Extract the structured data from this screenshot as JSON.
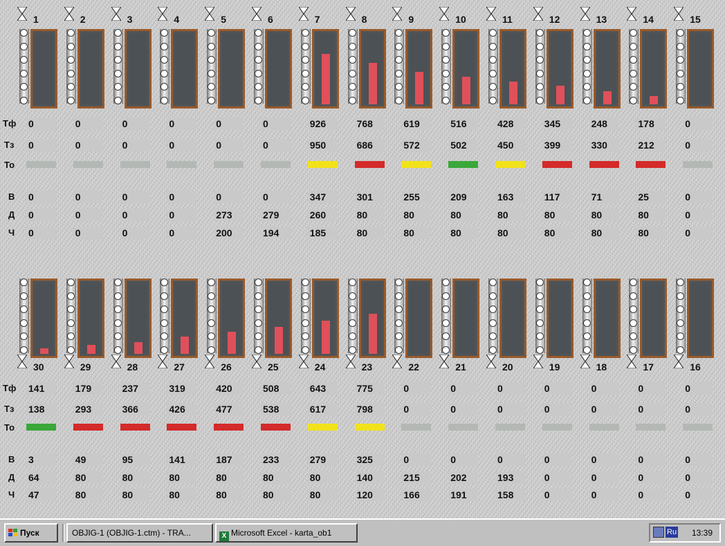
{
  "top": {
    "units": [
      {
        "n": "1",
        "fill": 0
      },
      {
        "n": "2",
        "fill": 0
      },
      {
        "n": "3",
        "fill": 0
      },
      {
        "n": "4",
        "fill": 0
      },
      {
        "n": "5",
        "fill": 0
      },
      {
        "n": "6",
        "fill": 0
      },
      {
        "n": "7",
        "fill": 0.71
      },
      {
        "n": "8",
        "fill": 0.58
      },
      {
        "n": "9",
        "fill": 0.46
      },
      {
        "n": "10",
        "fill": 0.39
      },
      {
        "n": "11",
        "fill": 0.32
      },
      {
        "n": "12",
        "fill": 0.26
      },
      {
        "n": "13",
        "fill": 0.18
      },
      {
        "n": "14",
        "fill": 0.12
      },
      {
        "n": "15",
        "fill": 0
      }
    ],
    "tf": [
      "0",
      "0",
      "0",
      "0",
      "0",
      "0",
      "926",
      "768",
      "619",
      "516",
      "428",
      "345",
      "248",
      "178",
      "0"
    ],
    "tz": [
      "0",
      "0",
      "0",
      "0",
      "0",
      "0",
      "950",
      "686",
      "572",
      "502",
      "450",
      "399",
      "330",
      "212",
      "0"
    ],
    "to": [
      "gray",
      "gray",
      "gray",
      "gray",
      "gray",
      "gray",
      "yellow",
      "red",
      "yellow",
      "green",
      "yellow",
      "red",
      "red",
      "red",
      "gray"
    ],
    "v": [
      "0",
      "0",
      "0",
      "0",
      "0",
      "0",
      "347",
      "301",
      "255",
      "209",
      "163",
      "117",
      "71",
      "25",
      "0"
    ],
    "d": [
      "0",
      "0",
      "0",
      "0",
      "273",
      "279",
      "260",
      "80",
      "80",
      "80",
      "80",
      "80",
      "80",
      "80",
      "0"
    ],
    "ch": [
      "0",
      "0",
      "0",
      "0",
      "200",
      "194",
      "185",
      "80",
      "80",
      "80",
      "80",
      "80",
      "80",
      "80",
      "0"
    ]
  },
  "bottom": {
    "units": [
      {
        "n": "30",
        "fill": 0.08
      },
      {
        "n": "29",
        "fill": 0.13
      },
      {
        "n": "28",
        "fill": 0.17
      },
      {
        "n": "27",
        "fill": 0.24
      },
      {
        "n": "26",
        "fill": 0.31
      },
      {
        "n": "25",
        "fill": 0.38
      },
      {
        "n": "24",
        "fill": 0.47
      },
      {
        "n": "23",
        "fill": 0.56
      },
      {
        "n": "22",
        "fill": 0
      },
      {
        "n": "21",
        "fill": 0
      },
      {
        "n": "20",
        "fill": 0
      },
      {
        "n": "19",
        "fill": 0
      },
      {
        "n": "18",
        "fill": 0
      },
      {
        "n": "17",
        "fill": 0
      },
      {
        "n": "16",
        "fill": 0
      }
    ],
    "tf": [
      "141",
      "179",
      "237",
      "319",
      "420",
      "508",
      "643",
      "775",
      "0",
      "0",
      "0",
      "0",
      "0",
      "0",
      "0"
    ],
    "tz": [
      "138",
      "293",
      "366",
      "426",
      "477",
      "538",
      "617",
      "798",
      "0",
      "0",
      "0",
      "0",
      "0",
      "0",
      "0"
    ],
    "to": [
      "green",
      "red",
      "red",
      "red",
      "red",
      "red",
      "yellow",
      "yellow",
      "gray",
      "gray",
      "gray",
      "gray",
      "gray",
      "gray",
      "gray"
    ],
    "v": [
      "3",
      "49",
      "95",
      "141",
      "187",
      "233",
      "279",
      "325",
      "0",
      "0",
      "0",
      "0",
      "0",
      "0",
      "0"
    ],
    "d": [
      "64",
      "80",
      "80",
      "80",
      "80",
      "80",
      "80",
      "140",
      "215",
      "202",
      "193",
      "0",
      "0",
      "0",
      "0"
    ],
    "ch": [
      "47",
      "80",
      "80",
      "80",
      "80",
      "80",
      "80",
      "120",
      "166",
      "191",
      "158",
      "0",
      "0",
      "0",
      "0"
    ]
  },
  "labels": {
    "tf": "Тф",
    "tz": "Тз",
    "to": "То",
    "v": "В",
    "d": "Д",
    "ch": "Ч"
  },
  "colors": {
    "gray": "#b4b8b4",
    "yellow": "#f2e21a",
    "red": "#d42a2a",
    "green": "#3aa83a",
    "fill": "#e0505a",
    "vessel_border": "#9a5a2a"
  },
  "taskbar": {
    "start_label": "Пуск",
    "task1_label": "OBJIG-1 (OBJIG-1.ctm) - TRA...",
    "task2_label": "Microsoft Excel - karta_ob1",
    "lang": "Ru",
    "clock": "13:39"
  }
}
